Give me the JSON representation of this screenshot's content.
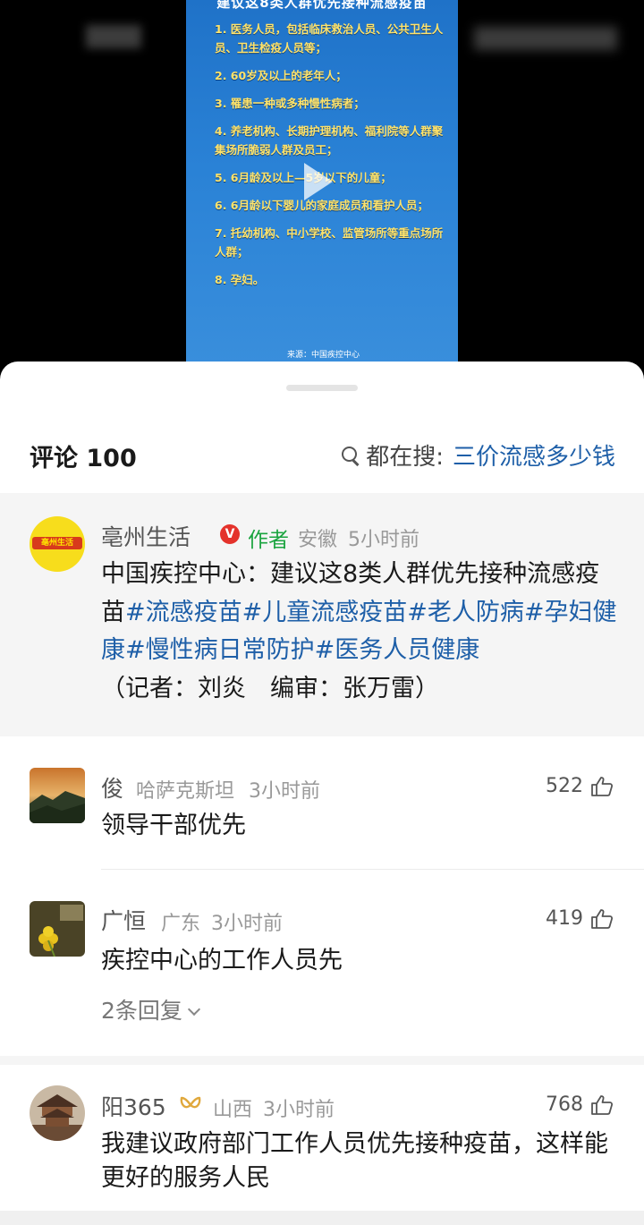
{
  "video": {
    "poster_title": "建议这8类人群优先接种流感疫苗",
    "items": [
      "1. 医务人员，包括临床救治人员、公共卫生人员、卫生检疫人员等；",
      "2. 60岁及以上的老年人；",
      "3. 罹患一种或多种慢性病者；",
      "4. 养老机构、长期护理机构、福利院等人群聚集场所脆弱人群及员工；",
      "5. 6月龄及以上—5岁以下的儿童；",
      "6. 6月龄以下婴儿的家庭成员和看护人员；",
      "7. 托幼机构、中小学校、监管场所等重点场所人群；",
      "8. 孕妇。"
    ],
    "source": "来源：中国疾控中心"
  },
  "header": {
    "comment_count": "评论 100",
    "search_prefix": "都在搜:",
    "search_term": "三价流感多少钱"
  },
  "author_comment": {
    "avatar_text": "亳州生活",
    "name": "亳州生活",
    "verify_mark": "V",
    "tag": "作者",
    "location": "安徽",
    "time": "5小时前",
    "text_prefix": "中国疾控中心：建议这8类人群优先接种流感疫苗",
    "hashtags": [
      "#流感疫苗",
      "#儿童流感疫苗",
      "#老人防病",
      "#孕妇健康",
      "#慢性病日常防护",
      "#医务人员健康"
    ],
    "text_suffix": "（记者：刘炎　编审：张万雷）"
  },
  "comments": [
    {
      "name": "俊",
      "location": "哈萨克斯坦",
      "time": "3小时前",
      "likes": "522",
      "text": "领导干部优先"
    },
    {
      "name": "广恒",
      "location": "广东",
      "time": "3小时前",
      "likes": "419",
      "text": "疾控中心的工作人员先",
      "replies": "2条回复"
    },
    {
      "name": "阳365",
      "location": "山西",
      "time": "3小时前",
      "likes": "768",
      "text": "我建议政府部门工作人员优先接种疫苗，这样能更好的服务人民"
    }
  ],
  "colors": {
    "hashtag": "#1e5fa8",
    "author_tag": "#1aa43f",
    "verify": "#e4322b",
    "poster_bg": "#2a82d6",
    "poster_text": "#ffe36a"
  }
}
